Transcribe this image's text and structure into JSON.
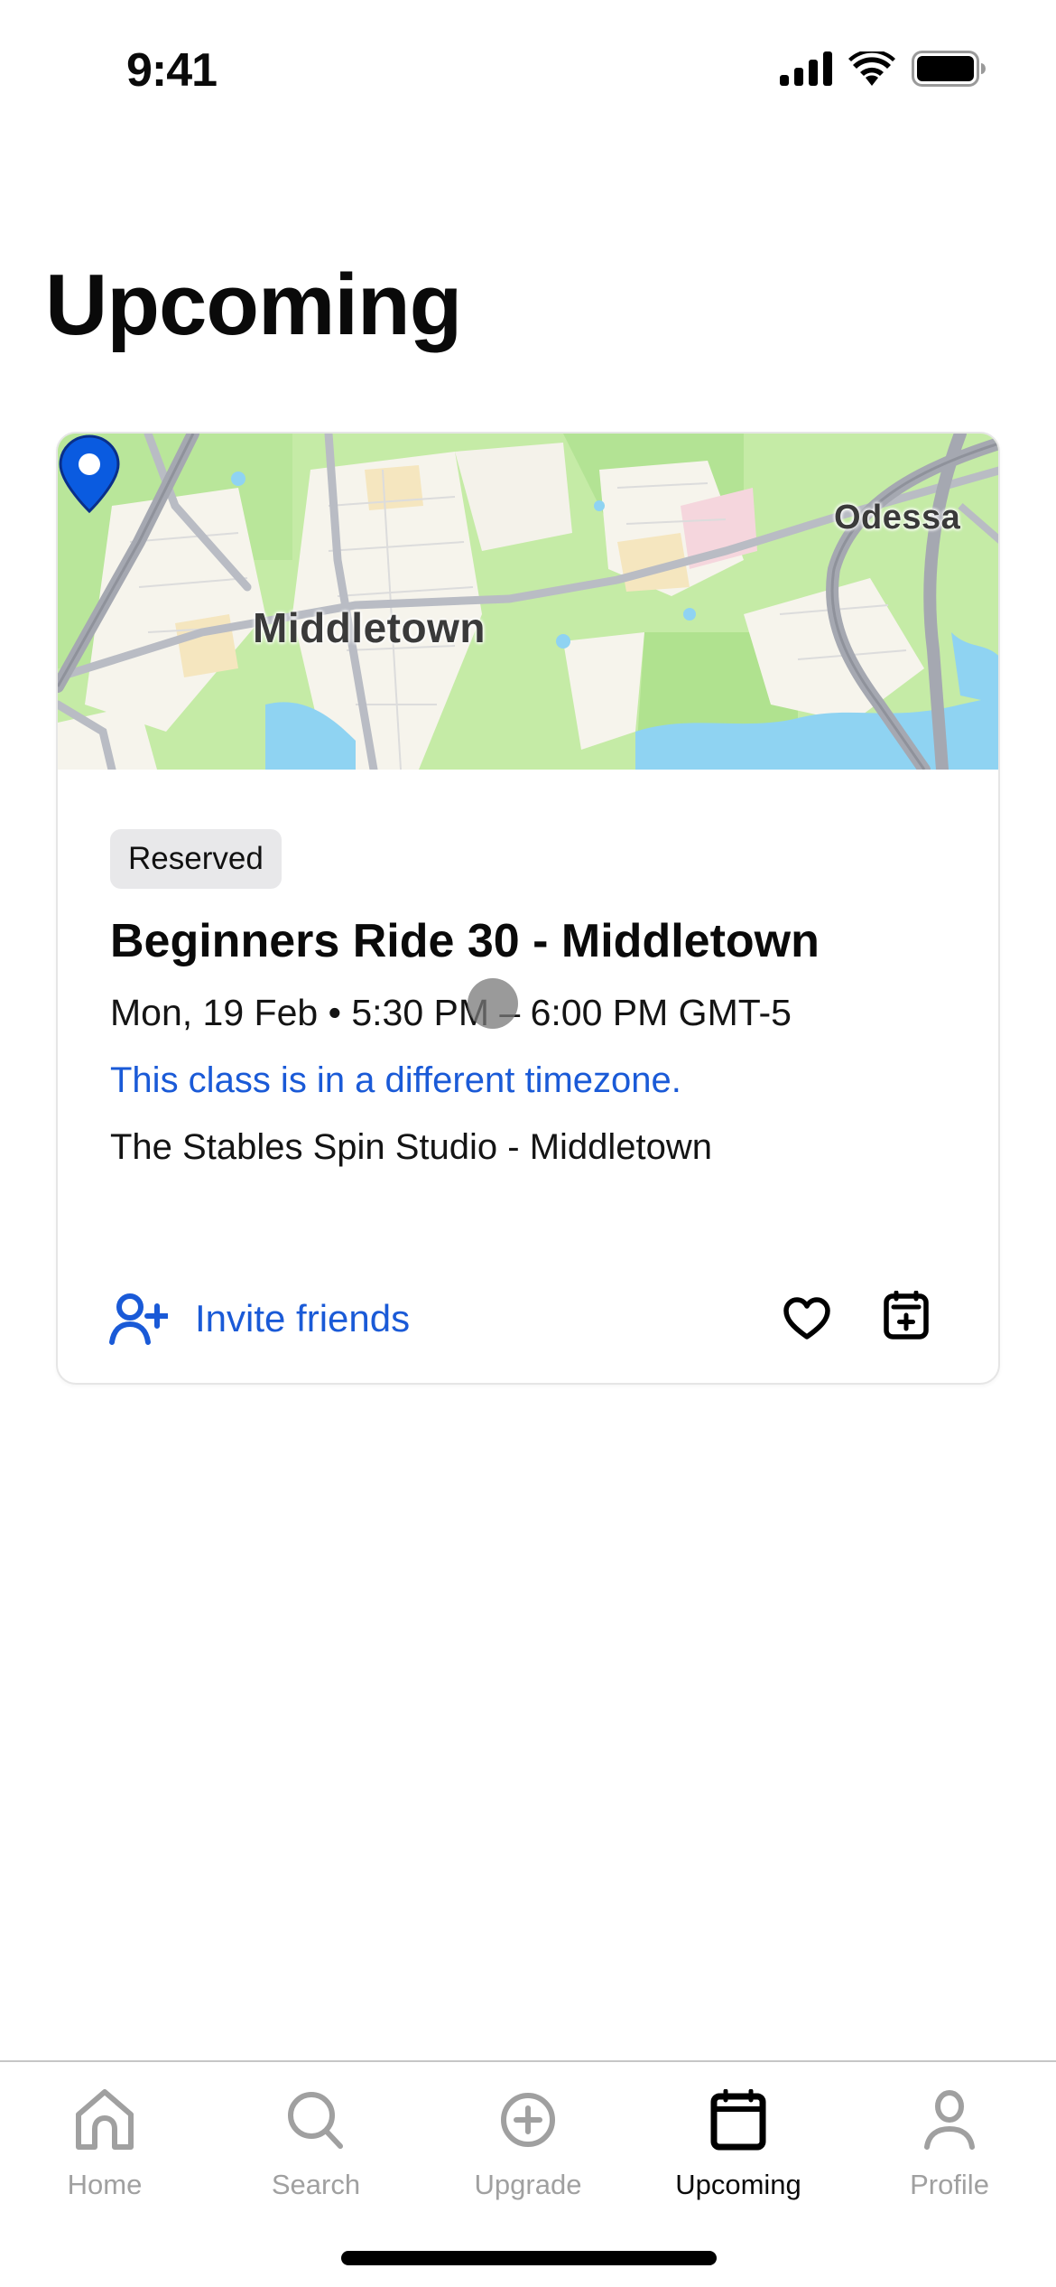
{
  "status_bar": {
    "time": "9:41",
    "icons": [
      "cellular-signal-icon",
      "wifi-icon",
      "battery-icon"
    ]
  },
  "page": {
    "title": "Upcoming"
  },
  "booking_card": {
    "map": {
      "labels": {
        "town": "Middletown",
        "nearby": "Odessa"
      },
      "pin_icon": "location-pin-icon",
      "pin_color": "#0a5be0"
    },
    "status_badge": "Reserved",
    "class_title": "Beginners Ride 30 - Middletown",
    "schedule": "Mon, 19 Feb • 5:30 PM – 6:00 PM GMT-5",
    "timezone_note": "This class is in a different timezone.",
    "studio": "The Stables Spin Studio - Middletown",
    "actions": {
      "invite_label": "Invite friends",
      "invite_icon": "person-add-icon",
      "favorite_icon": "heart-icon",
      "add_to_calendar_icon": "calendar-add-icon"
    }
  },
  "tab_bar": {
    "active": "Upcoming",
    "tabs": [
      {
        "label": "Home",
        "icon": "home-icon"
      },
      {
        "label": "Search",
        "icon": "search-icon"
      },
      {
        "label": "Upgrade",
        "icon": "plus-circle-icon"
      },
      {
        "label": "Upcoming",
        "icon": "calendar-icon"
      },
      {
        "label": "Profile",
        "icon": "person-icon"
      }
    ]
  },
  "colors": {
    "accent_blue": "#1a5ad7",
    "inactive_gray": "#a0a0a0",
    "badge_bg": "#e8e8ea"
  }
}
